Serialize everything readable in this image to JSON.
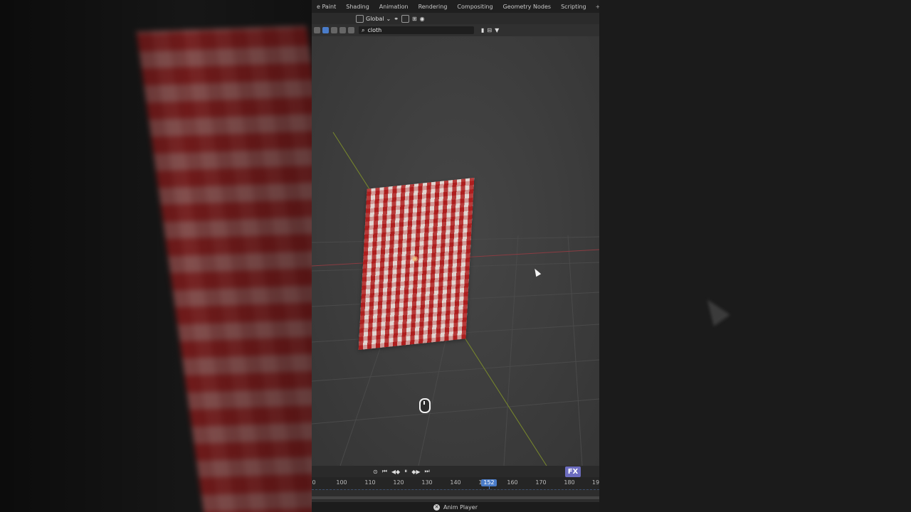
{
  "workspace_tabs": [
    "e Paint",
    "Shading",
    "Animation",
    "Rendering",
    "Compositing",
    "Geometry Nodes",
    "Scripting"
  ],
  "add_tab_label": "+",
  "header": {
    "transform_orientation": "Global"
  },
  "outliner": {
    "search_value": "cloth"
  },
  "timeline": {
    "ticks": [
      "0",
      "100",
      "110",
      "120",
      "130",
      "140",
      "1",
      "160",
      "170",
      "180",
      "19"
    ],
    "current_frame": "152"
  },
  "brand_logo": "FX",
  "status_bar": {
    "label": "Anim Player"
  },
  "colors": {
    "accent": "#4a7cc9",
    "cloth_red": "#b41c1c"
  }
}
